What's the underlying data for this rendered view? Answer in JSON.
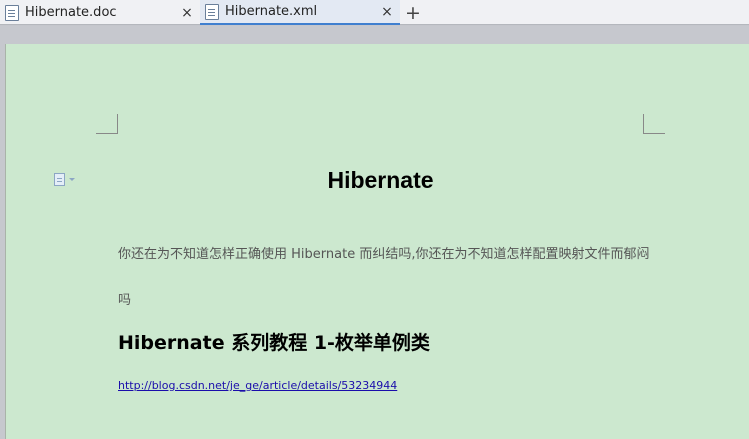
{
  "tabs": [
    {
      "label": "Hibernate.doc",
      "active": false
    },
    {
      "label": "Hibernate.xml",
      "active": true
    }
  ],
  "tab_close_glyph": "×",
  "add_tab_glyph": "+",
  "document": {
    "title": "Hibernate",
    "paragraph": "你还在为不知道怎样正确使用 Hibernate 而纠结吗,你还在为不知道怎样配置映射文件而郁闷吗",
    "heading": "Hibernate  系列教程 1-枚举单例类",
    "link": "http://blog.csdn.net/je_ge/article/details/53234944"
  },
  "colors": {
    "page_background": "#cce8cf",
    "active_tab_accent": "#3f7fcf",
    "link_color": "#1a0dab"
  },
  "icons": {
    "tab_icon": "document-icon",
    "margin_icon": "document-icon"
  }
}
